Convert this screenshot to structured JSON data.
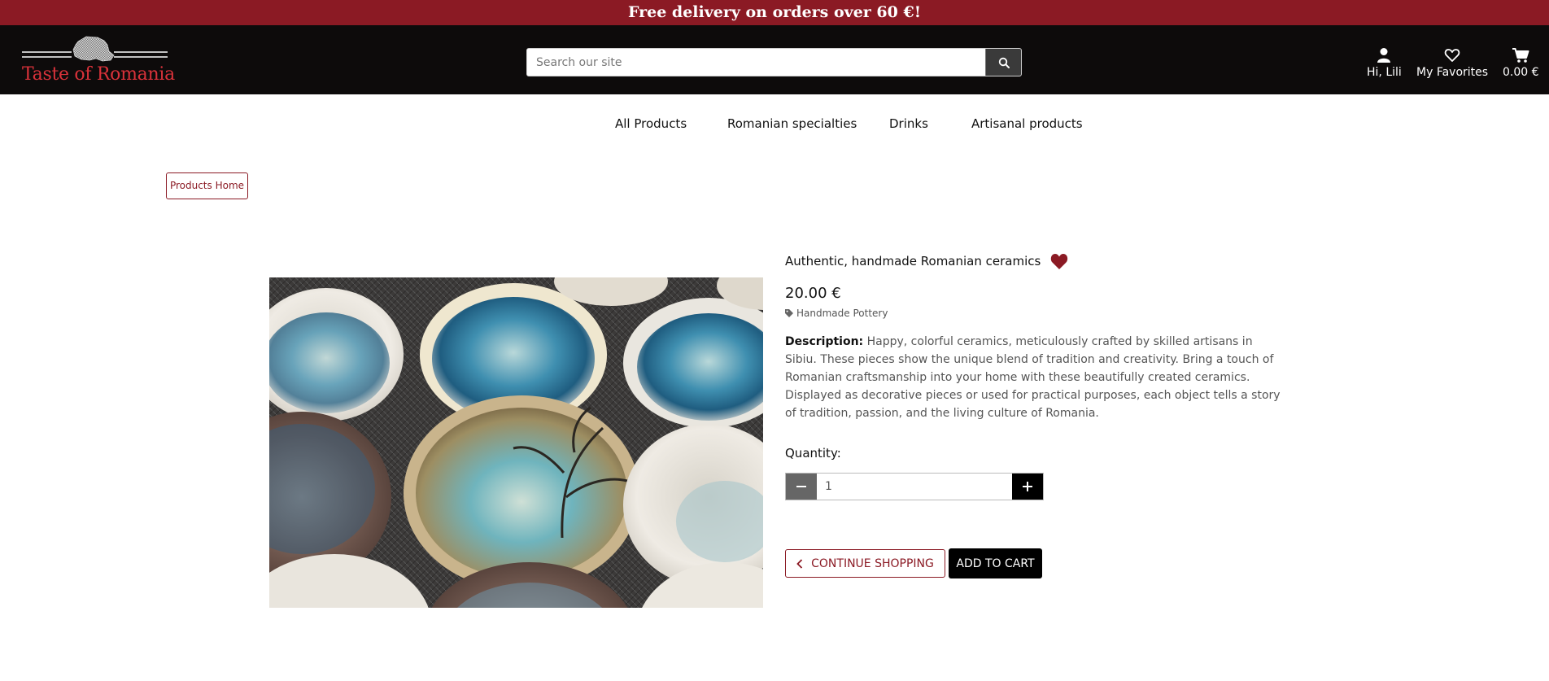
{
  "banner": {
    "text": "Free delivery on orders over 60 €!"
  },
  "header": {
    "logo_text": "Taste of Romania",
    "search_placeholder": "Search our site",
    "user_label": "Hi, Lili",
    "favorites_label": "My Favorites",
    "cart_total": "0.00 €"
  },
  "nav": {
    "items": [
      {
        "label": "All Products"
      },
      {
        "label": "Romanian specialties"
      },
      {
        "label": "Drinks"
      },
      {
        "label": "Artisanal products"
      }
    ]
  },
  "breadcrumb": {
    "label": "Products Home"
  },
  "product": {
    "title": "Authentic, handmade Romanian ceramics",
    "price": "20.00 €",
    "category": "Handmade Pottery",
    "description_label": "Description:",
    "description": "Happy, colorful ceramics, meticulously crafted by skilled artisans in Sibiu. These pieces show the unique blend of tradition and creativity. Bring a touch of Romanian craftsmanship into your home with these beautifully created ceramics. Displayed as decorative pieces or used for practical purposes, each object tells a story of tradition, passion, and the living culture of Romania.",
    "quantity_label": "Quantity:",
    "quantity_value": "1"
  },
  "actions": {
    "continue_label": "CONTINUE SHOPPING",
    "add_to_cart_label": "ADD TO CART"
  },
  "colors": {
    "brand_red": "#8b1a24",
    "header_bg": "#0d0b0b",
    "logo_red": "#d9323a"
  },
  "icons": [
    "map-logo-icon",
    "search-icon",
    "user-icon",
    "heart-outline-icon",
    "cart-icon",
    "heart-filled-icon",
    "tag-icon",
    "minus-icon",
    "plus-icon",
    "chevron-left-icon"
  ]
}
